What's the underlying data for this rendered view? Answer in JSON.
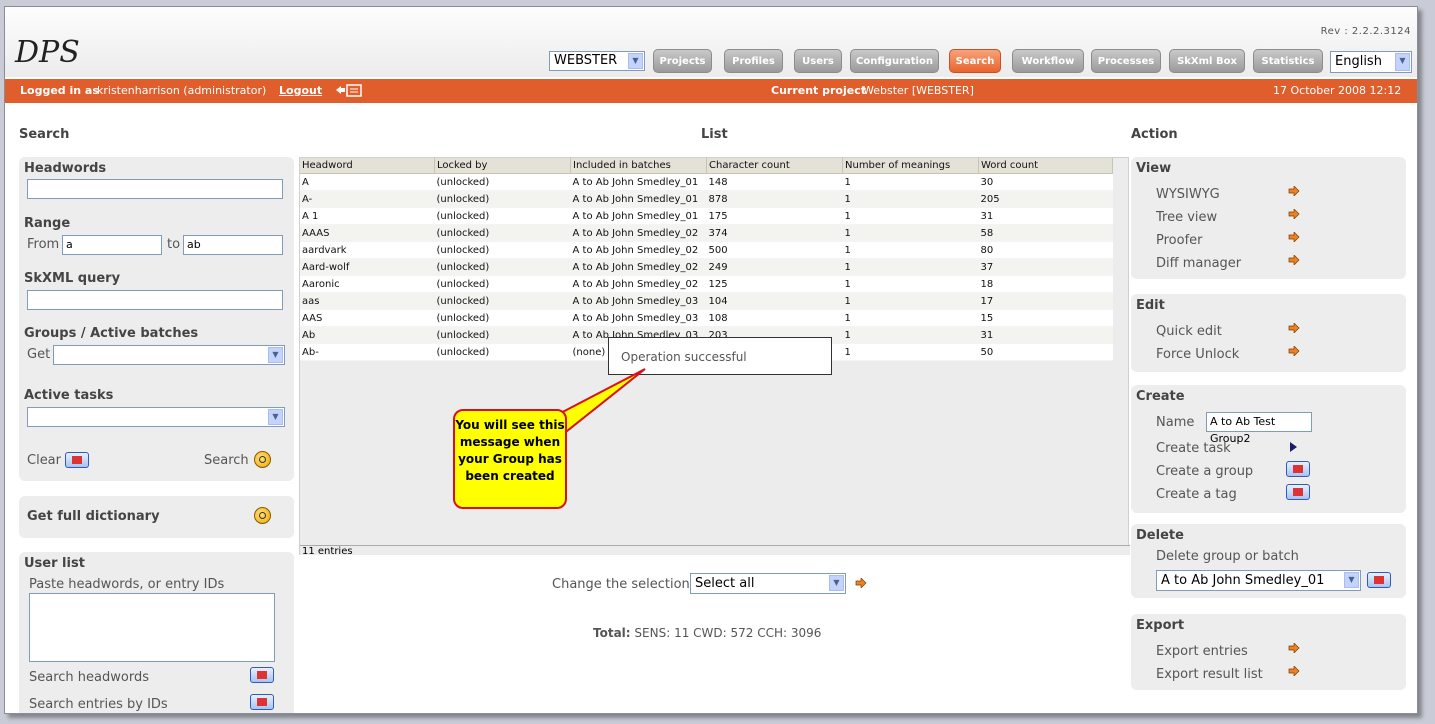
{
  "app": {
    "logo": "DPS",
    "rev": "Rev : 2.2.2.3124"
  },
  "header": {
    "project_select": "WEBSTER",
    "nav": [
      "Projects",
      "Profiles",
      "Users",
      "Configuration",
      "Search",
      "Workflow",
      "Processes",
      "SkXml Box",
      "Statistics"
    ],
    "active_nav": "Search",
    "language": "English"
  },
  "status": {
    "logged_label": "Logged in as",
    "user": "kristenharrison (administrator)",
    "logout": "Logout",
    "current_project_label": "Current project",
    "current_project": "Webster [WEBSTER]",
    "datetime": "17 October 2008 12:12"
  },
  "search": {
    "title": "Search",
    "headwords_label": "Headwords",
    "range_label": "Range",
    "from_label": "From",
    "from_value": "a",
    "to_label": "to",
    "to_value": "ab",
    "skxml_label": "SkXML query",
    "groups_label": "Groups / Active batches",
    "get_label": "Get",
    "active_tasks_label": "Active tasks",
    "clear_label": "Clear",
    "search_label": "Search",
    "full_dict_label": "Get full dictionary",
    "user_list_title": "User list",
    "user_list_hint": "Paste headwords, or entry IDs",
    "search_headwords": "Search headwords",
    "search_ids": "Search entries by IDs"
  },
  "list": {
    "title": "List",
    "columns": [
      "Headword",
      "Locked by",
      "Included in batches",
      "Character count",
      "Number of meanings",
      "Word count"
    ],
    "rows": [
      [
        "A",
        "(unlocked)",
        "A to Ab John Smedley_01",
        "148",
        "1",
        "30"
      ],
      [
        "A-",
        "(unlocked)",
        "A to Ab John Smedley_01",
        "878",
        "1",
        "205"
      ],
      [
        "A 1",
        "(unlocked)",
        "A to Ab John Smedley_01",
        "175",
        "1",
        "31"
      ],
      [
        "AAAS",
        "(unlocked)",
        "A to Ab John Smedley_02",
        "374",
        "1",
        "58"
      ],
      [
        "aardvark",
        "(unlocked)",
        "A to Ab John Smedley_02",
        "500",
        "1",
        "80"
      ],
      [
        "Aard-wolf",
        "(unlocked)",
        "A to Ab John Smedley_02",
        "249",
        "1",
        "37"
      ],
      [
        "Aaronic",
        "(unlocked)",
        "A to Ab John Smedley_02",
        "125",
        "1",
        "18"
      ],
      [
        "aas",
        "(unlocked)",
        "A to Ab John Smedley_03",
        "104",
        "1",
        "17"
      ],
      [
        "AAS",
        "(unlocked)",
        "A to Ab John Smedley_03",
        "108",
        "1",
        "15"
      ],
      [
        "Ab",
        "(unlocked)",
        "A to Ab John Smedley_03",
        "203",
        "1",
        "31"
      ],
      [
        "Ab-",
        "(unlocked)",
        "(none)",
        "",
        "1",
        "50"
      ]
    ],
    "entries": "11 entries",
    "popup": "Operation successful",
    "callout": "You will see this message when your Group has been created",
    "change_label": "Change the selection",
    "change_value": "Select all",
    "total_label": "Total:",
    "total_value": "SENS: 11 CWD: 572 CCH: 3096"
  },
  "action": {
    "title": "Action",
    "view_title": "View",
    "view_items": [
      "WYSIWYG",
      "Tree view",
      "Proofer",
      "Diff manager"
    ],
    "edit_title": "Edit",
    "edit_items": [
      "Quick edit",
      "Force Unlock"
    ],
    "create_title": "Create",
    "name_label": "Name",
    "name_value": "A to Ab Test Group2",
    "create_task": "Create task",
    "create_group": "Create a group",
    "create_tag": "Create a tag",
    "delete_title": "Delete",
    "delete_label": "Delete group or batch",
    "delete_value": "A to Ab John Smedley_01",
    "export_title": "Export",
    "export_items": [
      "Export entries",
      "Export result list"
    ]
  }
}
